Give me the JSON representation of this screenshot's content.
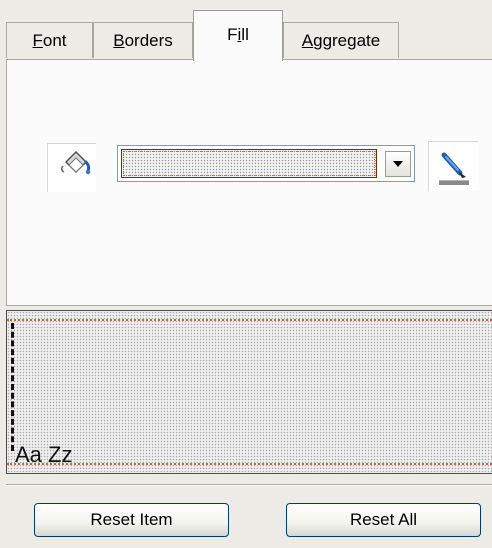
{
  "tabs": [
    {
      "id": "font",
      "label": "Font",
      "mnemonic": "F",
      "rest": "ont",
      "active": false
    },
    {
      "id": "borders",
      "label": "Borders",
      "mnemonic": "B",
      "rest": "orders",
      "active": false
    },
    {
      "id": "fill",
      "label": "Fill",
      "pre": "F",
      "mnemonic": "i",
      "rest": "ll",
      "active": true
    },
    {
      "id": "aggregate",
      "label": "Aggregate",
      "mnemonic": "A",
      "rest": "ggregate",
      "active": false
    }
  ],
  "fill": {
    "icon": "paint-bucket-icon",
    "color_combo_value": "",
    "dropdown_icon": "chevron-down-icon",
    "picker_icon": "color-picker-pen-icon"
  },
  "preview": {
    "sample_text": "Aa Zz",
    "border_color": "#c8673a"
  },
  "buttons": {
    "reset_item": "Reset Item",
    "reset_all": "Reset All"
  },
  "colors": {
    "window_bg": "#ecebe6",
    "panel_bg": "#fbfbfb",
    "button_border": "#003c74",
    "combo_border": "#7a2c00"
  }
}
